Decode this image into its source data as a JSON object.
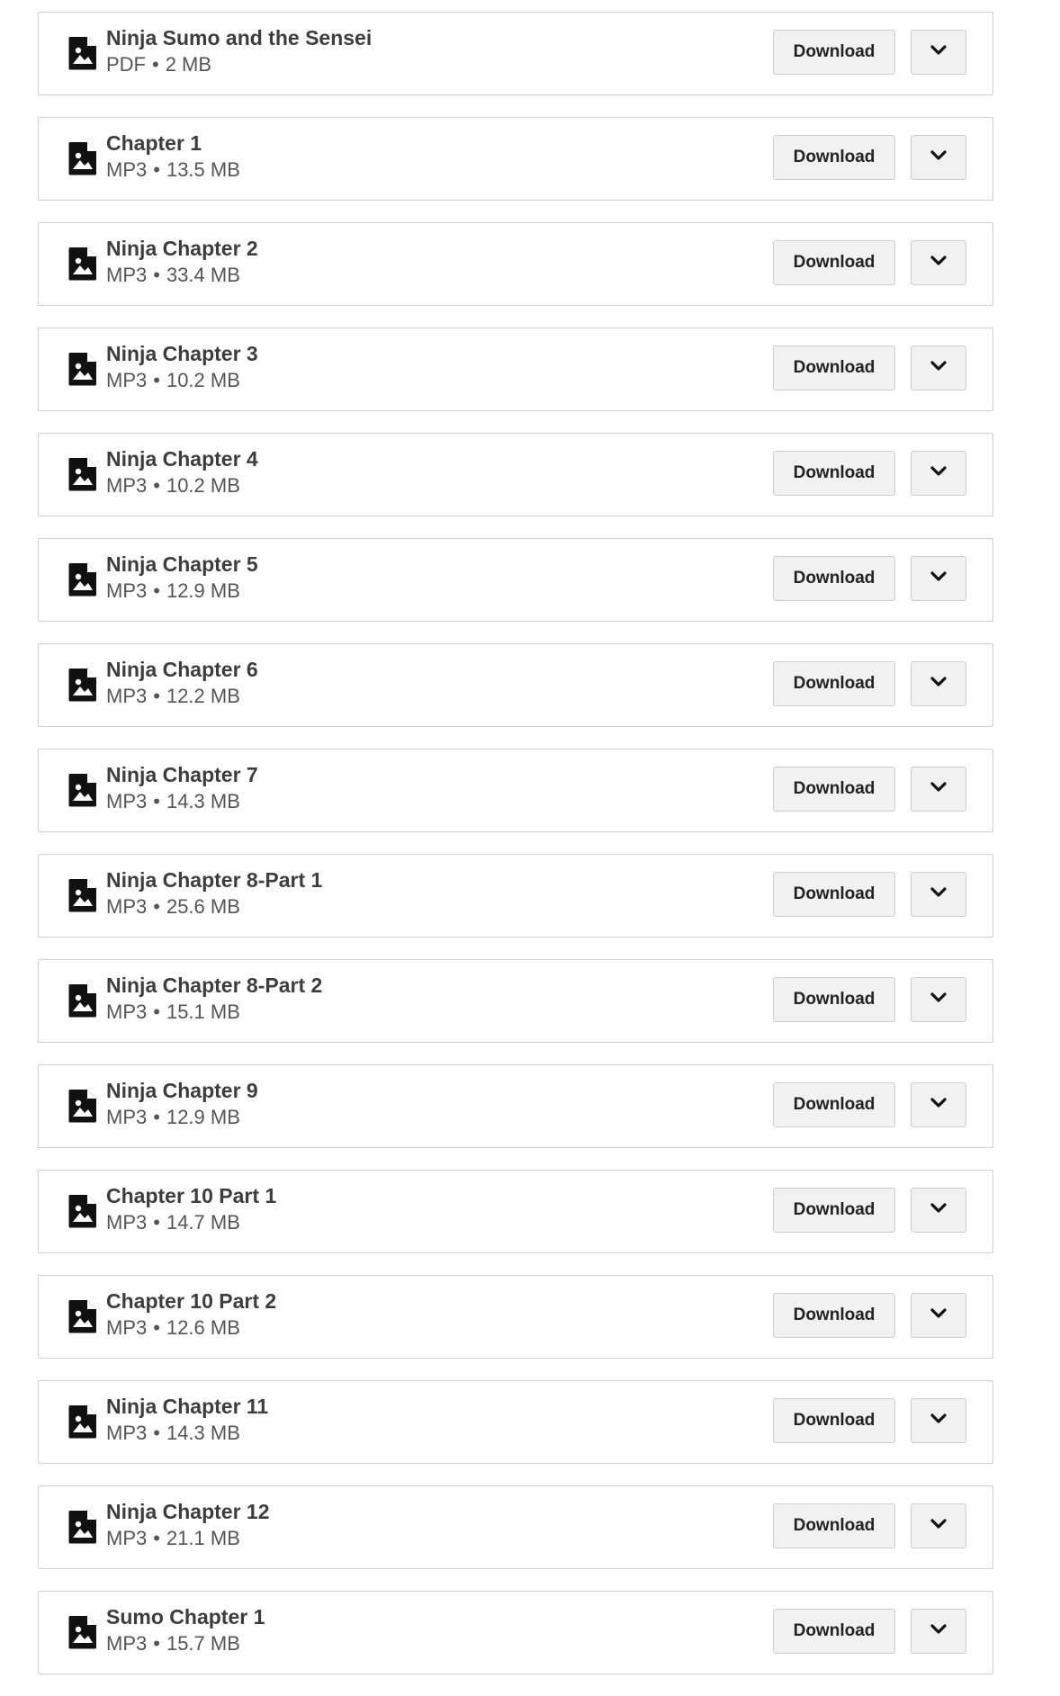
{
  "download_label": "Download",
  "meta_separator": "•",
  "files": [
    {
      "name": "Ninja Sumo and the Sensei",
      "type": "PDF",
      "size": "2 MB"
    },
    {
      "name": "Chapter 1",
      "type": "MP3",
      "size": "13.5 MB"
    },
    {
      "name": "Ninja Chapter 2",
      "type": "MP3",
      "size": "33.4 MB"
    },
    {
      "name": "Ninja Chapter 3",
      "type": "MP3",
      "size": "10.2 MB"
    },
    {
      "name": "Ninja Chapter 4",
      "type": "MP3",
      "size": "10.2 MB"
    },
    {
      "name": "Ninja Chapter 5",
      "type": "MP3",
      "size": "12.9 MB"
    },
    {
      "name": "Ninja Chapter 6",
      "type": "MP3",
      "size": "12.2 MB"
    },
    {
      "name": "Ninja Chapter 7",
      "type": "MP3",
      "size": "14.3 MB"
    },
    {
      "name": "Ninja Chapter 8-Part 1",
      "type": "MP3",
      "size": "25.6 MB"
    },
    {
      "name": "Ninja Chapter 8-Part 2",
      "type": "MP3",
      "size": "15.1 MB"
    },
    {
      "name": "Ninja Chapter 9",
      "type": "MP3",
      "size": "12.9 MB"
    },
    {
      "name": "Chapter 10 Part 1",
      "type": "MP3",
      "size": "14.7 MB"
    },
    {
      "name": "Chapter 10 Part 2",
      "type": "MP3",
      "size": "12.6 MB"
    },
    {
      "name": "Ninja Chapter 11",
      "type": "MP3",
      "size": "14.3 MB"
    },
    {
      "name": "Ninja Chapter 12",
      "type": "MP3",
      "size": "21.1 MB"
    },
    {
      "name": "Sumo Chapter 1",
      "type": "MP3",
      "size": "15.7 MB"
    }
  ],
  "icons": {
    "file": "image-file-icon",
    "expand": "chevron-down-icon"
  },
  "colors": {
    "border": "#cfcfcf",
    "button_bg": "#f1f1f1",
    "text_dark": "#3d3d3d",
    "icon": "#111111"
  }
}
